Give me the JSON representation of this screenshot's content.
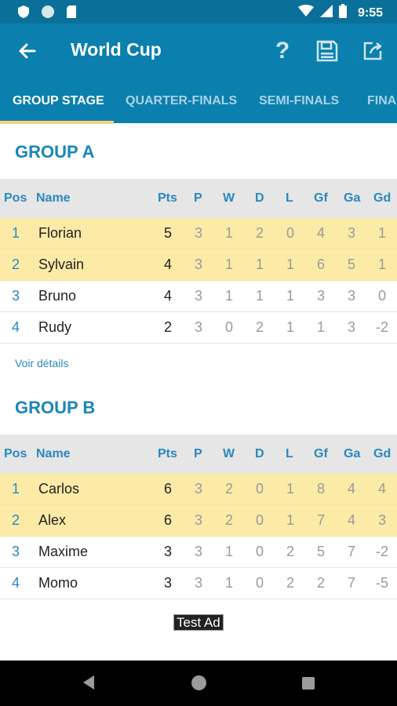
{
  "status_bar": {
    "time": "9:55"
  },
  "app_bar": {
    "title": "World Cup",
    "help_label": "?"
  },
  "tabs": [
    {
      "label": "GROUP STAGE"
    },
    {
      "label": "QUARTER-FINALS"
    },
    {
      "label": "SEMI-FINALS"
    },
    {
      "label": "FINA"
    }
  ],
  "columns": {
    "pos": "Pos",
    "name": "Name",
    "pts": "Pts",
    "p": "P",
    "w": "W",
    "d": "D",
    "l": "L",
    "gf": "Gf",
    "ga": "Ga",
    "gd": "Gd"
  },
  "groups": [
    {
      "title": "GROUP A",
      "details_link": "Voir détails",
      "rows": [
        {
          "pos": "1",
          "name": "Florian",
          "pts": "5",
          "p": "3",
          "w": "1",
          "d": "2",
          "l": "0",
          "gf": "4",
          "ga": "3",
          "gd": "1"
        },
        {
          "pos": "2",
          "name": "Sylvain",
          "pts": "4",
          "p": "3",
          "w": "1",
          "d": "1",
          "l": "1",
          "gf": "6",
          "ga": "5",
          "gd": "1"
        },
        {
          "pos": "3",
          "name": "Bruno",
          "pts": "4",
          "p": "3",
          "w": "1",
          "d": "1",
          "l": "1",
          "gf": "3",
          "ga": "3",
          "gd": "0"
        },
        {
          "pos": "4",
          "name": "Rudy",
          "pts": "2",
          "p": "3",
          "w": "0",
          "d": "2",
          "l": "1",
          "gf": "1",
          "ga": "3",
          "gd": "-2"
        }
      ]
    },
    {
      "title": "GROUP B",
      "rows": [
        {
          "pos": "1",
          "name": "Carlos",
          "pts": "6",
          "p": "3",
          "w": "2",
          "d": "0",
          "l": "1",
          "gf": "8",
          "ga": "4",
          "gd": "4"
        },
        {
          "pos": "2",
          "name": "Alex",
          "pts": "6",
          "p": "3",
          "w": "2",
          "d": "0",
          "l": "1",
          "gf": "7",
          "ga": "4",
          "gd": "3"
        },
        {
          "pos": "3",
          "name": "Maxime",
          "pts": "3",
          "p": "3",
          "w": "1",
          "d": "0",
          "l": "2",
          "gf": "5",
          "ga": "7",
          "gd": "-2"
        },
        {
          "pos": "4",
          "name": "Momo",
          "pts": "3",
          "p": "3",
          "w": "1",
          "d": "0",
          "l": "2",
          "gf": "2",
          "ga": "7",
          "gd": "-5"
        }
      ]
    }
  ],
  "ad_label": "Test Ad",
  "colors": {
    "primary": "#0b7fad",
    "status_bar": "#0b7099",
    "accent_text": "#1a86b9",
    "qualified_row": "#fbeba6",
    "tab_indicator": "#f4d37a"
  }
}
